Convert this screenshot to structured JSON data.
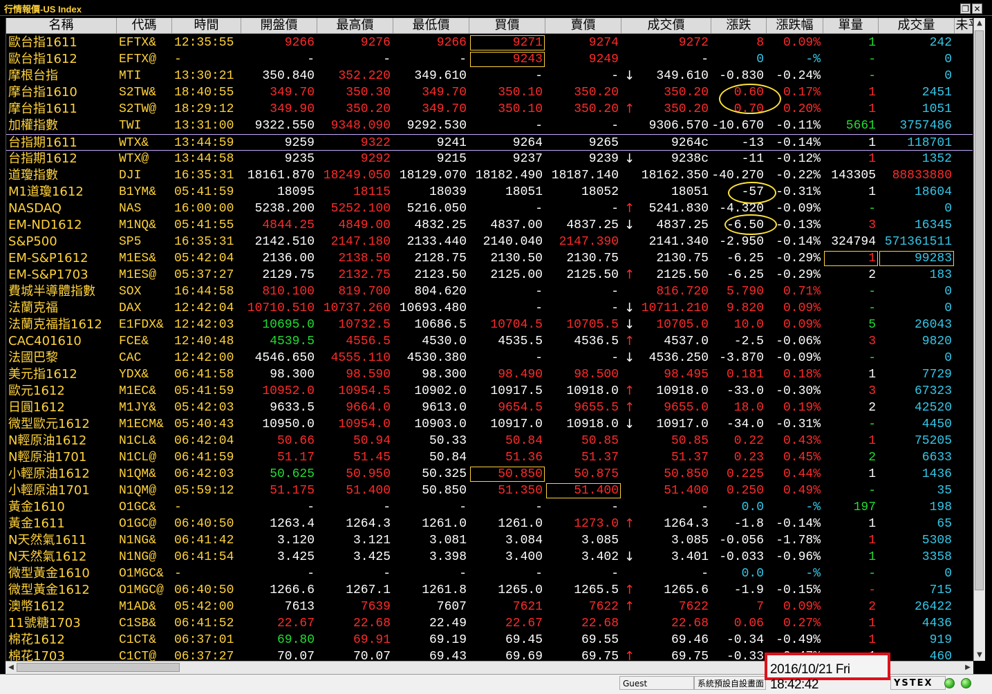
{
  "window": {
    "title": "行情報價-US Index"
  },
  "columns": [
    "名稱",
    "代碼",
    "時間",
    "開盤價",
    "最高價",
    "最低價",
    "買價",
    "賣價",
    "成交價",
    "漲跌",
    "漲跌幅",
    "單量",
    "成交量",
    "未平"
  ],
  "rows": [
    [
      "歐台指1611",
      "EFTX&",
      "12:35:55",
      "9266",
      "9276",
      "9266",
      "9271",
      "9274",
      "",
      "9272",
      "8",
      "0.09%",
      "1",
      "242"
    ],
    [
      "歐台指1612",
      "EFTX@",
      "-",
      "-",
      "-",
      "-",
      "9243",
      "9249",
      "",
      "-",
      "0",
      "-%",
      "-",
      "0"
    ],
    [
      "摩根台指",
      "MTI",
      "13:30:21",
      "350.840",
      "352.220",
      "349.610",
      "-",
      "-",
      "↓",
      "349.610",
      "-0.830",
      "-0.24%",
      "-",
      "0"
    ],
    [
      "摩台指1610",
      "S2TW&",
      "18:40:55",
      "349.70",
      "350.30",
      "349.70",
      "350.10",
      "350.20",
      "",
      "350.20",
      "0.60",
      "0.17%",
      "1",
      "2451"
    ],
    [
      "摩台指1611",
      "S2TW@",
      "18:29:12",
      "349.90",
      "350.20",
      "349.70",
      "350.10",
      "350.20",
      "↑",
      "350.20",
      "0.70",
      "0.20%",
      "1",
      "1051"
    ],
    [
      "加權指數",
      "TWI",
      "13:31:00",
      "9322.550",
      "9348.090",
      "9292.530",
      "-",
      "-",
      "",
      "9306.570",
      "-10.670",
      "-0.11%",
      "5661",
      "3757486"
    ],
    [
      "台指期1611",
      "WTX&",
      "13:44:59",
      "9259",
      "9322",
      "9241",
      "9264",
      "9265",
      "",
      "9264c",
      "-13",
      "-0.14%",
      "1",
      "118701"
    ],
    [
      "台指期1612",
      "WTX@",
      "13:44:58",
      "9235",
      "9292",
      "9215",
      "9237",
      "9239",
      "↓",
      "9238c",
      "-11",
      "-0.12%",
      "1",
      "1352"
    ],
    [
      "道瓊指數",
      "DJI",
      "16:35:31",
      "18161.870",
      "18249.050",
      "18129.070",
      "18182.490",
      "18187.140",
      "",
      "18162.350",
      "-40.270",
      "-0.22%",
      "143305",
      "88833880"
    ],
    [
      "M1道瓊1612",
      "B1YM&",
      "05:41:59",
      "18095",
      "18115",
      "18039",
      "18051",
      "18052",
      "",
      "18051",
      "-57",
      "-0.31%",
      "1",
      "18604"
    ],
    [
      "NASDAQ",
      "NAS",
      "16:00:00",
      "5238.200",
      "5252.100",
      "5216.050",
      "-",
      "-",
      "↑",
      "5241.830",
      "-4.320",
      "-0.09%",
      "-",
      "0"
    ],
    [
      "EM-ND1612",
      "M1NQ&",
      "05:41:55",
      "4844.25",
      "4849.00",
      "4832.25",
      "4837.00",
      "4837.25",
      "↓",
      "4837.25",
      "-6.50",
      "-0.13%",
      "3",
      "16345"
    ],
    [
      "S&P500",
      "SP5",
      "16:35:31",
      "2142.510",
      "2147.180",
      "2133.440",
      "2140.040",
      "2147.390",
      "",
      "2141.340",
      "-2.950",
      "-0.14%",
      "324794",
      "571361511"
    ],
    [
      "EM-S&P1612",
      "M1ES&",
      "05:42:04",
      "2136.00",
      "2138.50",
      "2128.75",
      "2130.50",
      "2130.75",
      "",
      "2130.75",
      "-6.25",
      "-0.29%",
      "1",
      "99283"
    ],
    [
      "EM-S&P1703",
      "M1ES@",
      "05:37:27",
      "2129.75",
      "2132.75",
      "2123.50",
      "2125.00",
      "2125.50",
      "↑",
      "2125.50",
      "-6.25",
      "-0.29%",
      "2",
      "183"
    ],
    [
      "費城半導體指數",
      "SOX",
      "16:44:58",
      "810.100",
      "819.700",
      "804.620",
      "-",
      "-",
      "",
      "816.720",
      "5.790",
      "0.71%",
      "-",
      "0"
    ],
    [
      "法蘭克福",
      "DAX",
      "12:42:04",
      "10710.510",
      "10737.260",
      "10693.480",
      "-",
      "-",
      "↓",
      "10711.210",
      "9.820",
      "0.09%",
      "-",
      "0"
    ],
    [
      "法蘭克福指1612",
      "E1FDX&",
      "12:42:03",
      "10695.0",
      "10732.5",
      "10686.5",
      "10704.5",
      "10705.5",
      "↓",
      "10705.0",
      "10.0",
      "0.09%",
      "5",
      "26043"
    ],
    [
      "CAC401610",
      "FCE&",
      "12:40:48",
      "4539.5",
      "4556.5",
      "4530.0",
      "4535.5",
      "4536.5",
      "↑",
      "4537.0",
      "-2.5",
      "-0.06%",
      "3",
      "9820"
    ],
    [
      "法國巴黎",
      "CAC",
      "12:42:00",
      "4546.650",
      "4555.110",
      "4530.380",
      "-",
      "-",
      "↓",
      "4536.250",
      "-3.870",
      "-0.09%",
      "-",
      "0"
    ],
    [
      "美元指1612",
      "YDX&",
      "06:41:58",
      "98.300",
      "98.590",
      "98.300",
      "98.490",
      "98.500",
      "",
      "98.495",
      "0.181",
      "0.18%",
      "1",
      "7729"
    ],
    [
      "歐元1612",
      "M1EC&",
      "05:41:59",
      "10952.0",
      "10954.5",
      "10902.0",
      "10917.5",
      "10918.0",
      "↑",
      "10918.0",
      "-33.0",
      "-0.30%",
      "3",
      "67323"
    ],
    [
      "日圓1612",
      "M1JY&",
      "05:42:03",
      "9633.5",
      "9664.0",
      "9613.0",
      "9654.5",
      "9655.5",
      "↑",
      "9655.0",
      "18.0",
      "0.19%",
      "2",
      "42520"
    ],
    [
      "微型歐元1612",
      "M1ECM&",
      "05:40:43",
      "10950.0",
      "10954.0",
      "10903.0",
      "10917.0",
      "10918.0",
      "↓",
      "10917.0",
      "-34.0",
      "-0.31%",
      "-",
      "4450"
    ],
    [
      "N輕原油1612",
      "N1CL&",
      "06:42:04",
      "50.66",
      "50.94",
      "50.33",
      "50.84",
      "50.85",
      "",
      "50.85",
      "0.22",
      "0.43%",
      "1",
      "75205"
    ],
    [
      "N輕原油1701",
      "N1CL@",
      "06:41:59",
      "51.17",
      "51.45",
      "50.84",
      "51.36",
      "51.37",
      "",
      "51.37",
      "0.23",
      "0.45%",
      "2",
      "6633"
    ],
    [
      "小輕原油1612",
      "N1QM&",
      "06:42:03",
      "50.625",
      "50.950",
      "50.325",
      "50.850",
      "50.875",
      "",
      "50.850",
      "0.225",
      "0.44%",
      "1",
      "1436"
    ],
    [
      "小輕原油1701",
      "N1QM@",
      "05:59:12",
      "51.175",
      "51.400",
      "50.850",
      "51.350",
      "51.400",
      "",
      "51.400",
      "0.250",
      "0.49%",
      "-",
      "35"
    ],
    [
      "黃金1610",
      "O1GC&",
      "-",
      "-",
      "-",
      "-",
      "-",
      "-",
      "",
      "-",
      "0.0",
      "-%",
      "197",
      "198"
    ],
    [
      "黃金1611",
      "O1GC@",
      "06:40:50",
      "1263.4",
      "1264.3",
      "1261.0",
      "1261.0",
      "1273.0",
      "↑",
      "1264.3",
      "-1.8",
      "-0.14%",
      "1",
      "65"
    ],
    [
      "N天然氣1611",
      "N1NG&",
      "06:41:42",
      "3.120",
      "3.121",
      "3.081",
      "3.084",
      "3.085",
      "",
      "3.085",
      "-0.056",
      "-1.78%",
      "1",
      "5308"
    ],
    [
      "N天然氣1612",
      "N1NG@",
      "06:41:54",
      "3.425",
      "3.425",
      "3.398",
      "3.400",
      "3.402",
      "↓",
      "3.401",
      "-0.033",
      "-0.96%",
      "1",
      "3358"
    ],
    [
      "微型黃金1610",
      "O1MGC&",
      "-",
      "-",
      "-",
      "-",
      "-",
      "-",
      "",
      "-",
      "0.0",
      "-%",
      "-",
      "0"
    ],
    [
      "微型黃金1612",
      "O1MGC@",
      "06:40:50",
      "1266.6",
      "1267.1",
      "1261.8",
      "1265.0",
      "1265.5",
      "↑",
      "1265.6",
      "-1.9",
      "-0.15%",
      "-",
      "715"
    ],
    [
      "澳幣1612",
      "M1AD&",
      "05:42:00",
      "7613",
      "7639",
      "7607",
      "7621",
      "7622",
      "↑",
      "7622",
      "7",
      "0.09%",
      "2",
      "26422"
    ],
    [
      "11號糖1703",
      "C1SB&",
      "06:41:52",
      "22.67",
      "22.68",
      "22.49",
      "22.67",
      "22.68",
      "",
      "22.68",
      "0.06",
      "0.27%",
      "1",
      "4436"
    ],
    [
      "棉花1612",
      "C1CT&",
      "06:37:01",
      "69.80",
      "69.91",
      "69.19",
      "69.45",
      "69.55",
      "",
      "69.46",
      "-0.34",
      "-0.49%",
      "1",
      "919"
    ],
    [
      "棉花1703",
      "C1CT@",
      "06:37:27",
      "70.07",
      "70.07",
      "69.43",
      "69.69",
      "69.75",
      "↑",
      "69.75",
      "-0.33",
      "-0.47%",
      "1",
      "460"
    ]
  ],
  "status": {
    "user": "Guest",
    "layout": "系統預設自設畫面",
    "datetime": "2016/10/21 Fri 18:42:42",
    "brand": "YSTEX"
  },
  "colors": {
    "yellow": "#ffd23a",
    "red": "#ff2a2a",
    "green": "#22dd33",
    "cyan": "#34c7e8",
    "white": "#ffffff",
    "highlight": "#e0101a"
  }
}
